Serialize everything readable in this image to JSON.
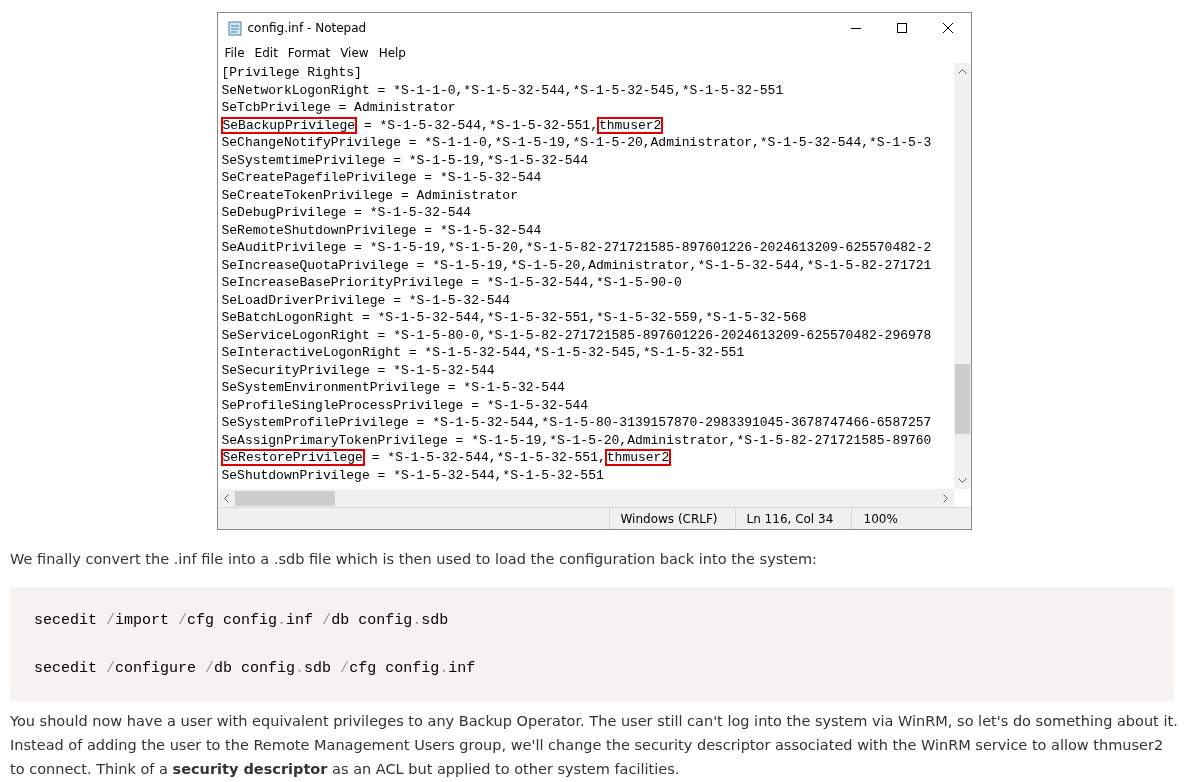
{
  "notepad": {
    "title": "config.inf - Notepad",
    "menu": [
      "File",
      "Edit",
      "Format",
      "View",
      "Help"
    ],
    "lines": [
      {
        "text": "[Privilege Rights]"
      },
      {
        "text": "SeNetworkLogonRight = *S-1-1-0,*S-1-5-32-544,*S-1-5-32-545,*S-1-5-32-551"
      },
      {
        "text": "SeTcbPrivilege = Administrator"
      },
      {
        "parts": [
          {
            "text": "SeBackupPrivilege",
            "boxed": true
          },
          {
            "text": " = *S-1-5-32-544,*S-1-5-32-551,",
            "boxed": false
          },
          {
            "text": "thmuser2",
            "boxed": true
          }
        ]
      },
      {
        "text": "SeChangeNotifyPrivilege = *S-1-1-0,*S-1-5-19,*S-1-5-20,Administrator,*S-1-5-32-544,*S-1-5-3"
      },
      {
        "text": "SeSystemtimePrivilege = *S-1-5-19,*S-1-5-32-544"
      },
      {
        "text": "SeCreatePagefilePrivilege = *S-1-5-32-544"
      },
      {
        "text": "SeCreateTokenPrivilege = Administrator"
      },
      {
        "text": "SeDebugPrivilege = *S-1-5-32-544"
      },
      {
        "text": "SeRemoteShutdownPrivilege = *S-1-5-32-544"
      },
      {
        "text": "SeAuditPrivilege = *S-1-5-19,*S-1-5-20,*S-1-5-82-271721585-897601226-2024613209-625570482-2"
      },
      {
        "text": "SeIncreaseQuotaPrivilege = *S-1-5-19,*S-1-5-20,Administrator,*S-1-5-32-544,*S-1-5-82-271721"
      },
      {
        "text": "SeIncreaseBasePriorityPrivilege = *S-1-5-32-544,*S-1-5-90-0"
      },
      {
        "text": "SeLoadDriverPrivilege = *S-1-5-32-544"
      },
      {
        "text": "SeBatchLogonRight = *S-1-5-32-544,*S-1-5-32-551,*S-1-5-32-559,*S-1-5-32-568"
      },
      {
        "text": "SeServiceLogonRight = *S-1-5-80-0,*S-1-5-82-271721585-897601226-2024613209-625570482-296978"
      },
      {
        "text": "SeInteractiveLogonRight = *S-1-5-32-544,*S-1-5-32-545,*S-1-5-32-551"
      },
      {
        "text": "SeSecurityPrivilege = *S-1-5-32-544"
      },
      {
        "text": "SeSystemEnvironmentPrivilege = *S-1-5-32-544"
      },
      {
        "text": "SeProfileSingleProcessPrivilege = *S-1-5-32-544"
      },
      {
        "text": "SeSystemProfilePrivilege = *S-1-5-32-544,*S-1-5-80-3139157870-2983391045-3678747466-6587257"
      },
      {
        "text": "SeAssignPrimaryTokenPrivilege = *S-1-5-19,*S-1-5-20,Administrator,*S-1-5-82-271721585-89760"
      },
      {
        "parts": [
          {
            "text": "SeRestorePrivilege",
            "boxed": true
          },
          {
            "text": " = *S-1-5-32-544,*S-1-5-32-551,",
            "boxed": false
          },
          {
            "text": "thmuser2",
            "boxed": true
          }
        ]
      },
      {
        "text": "SeShutdownPrivilege = *S-1-5-32-544,*S-1-5-32-551"
      }
    ],
    "status_bar": [
      "Windows (CRLF)",
      "Ln 116, Col 34",
      "100%"
    ]
  },
  "intro": "We finally convert the .inf file into a .sdb file which is then used to load the configuration back into the system:",
  "code": [
    [
      {
        "text": "secedit ",
        "kind": "plain"
      },
      {
        "text": "/",
        "kind": "punct"
      },
      {
        "text": "import ",
        "kind": "plain"
      },
      {
        "text": "/",
        "kind": "punct"
      },
      {
        "text": "cfg config",
        "kind": "plain"
      },
      {
        "text": ".",
        "kind": "punct"
      },
      {
        "text": "inf ",
        "kind": "plain"
      },
      {
        "text": "/",
        "kind": "punct"
      },
      {
        "text": "db config",
        "kind": "plain"
      },
      {
        "text": ".",
        "kind": "punct"
      },
      {
        "text": "sdb",
        "kind": "plain"
      }
    ],
    [
      {
        "text": "secedit ",
        "kind": "plain"
      },
      {
        "text": "/",
        "kind": "punct"
      },
      {
        "text": "configure ",
        "kind": "plain"
      },
      {
        "text": "/",
        "kind": "punct"
      },
      {
        "text": "db config",
        "kind": "plain"
      },
      {
        "text": ".",
        "kind": "punct"
      },
      {
        "text": "sdb ",
        "kind": "plain"
      },
      {
        "text": "/",
        "kind": "punct"
      },
      {
        "text": "cfg config",
        "kind": "plain"
      },
      {
        "text": ".",
        "kind": "punct"
      },
      {
        "text": "inf",
        "kind": "plain"
      }
    ]
  ],
  "outro": "You should now have a user with equivalent privileges to any Backup Operator. The user still can't log into the system via WinRM, so let's do something about it. Instead of adding the user to the Remote Management Users group, we'll change the security descriptor associated with the WinRM service to allow thmuser2 to connect. Think of a **security descriptor** as an ACL but applied to other system facilities."
}
